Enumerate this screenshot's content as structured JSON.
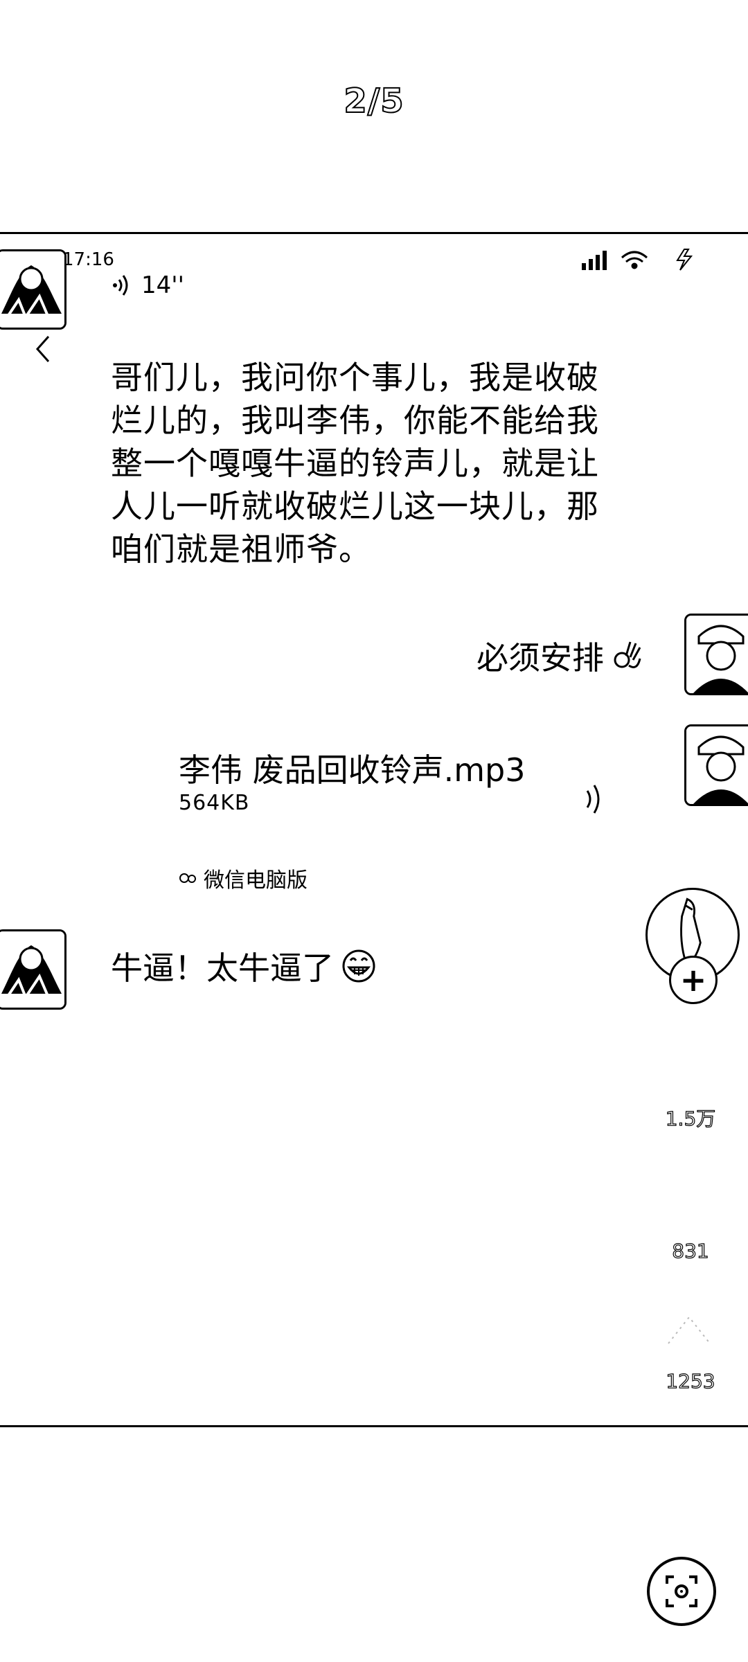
{
  "viewer": {
    "page_counter": "2/5"
  },
  "status_bar": {
    "time": "17:16"
  },
  "chat": {
    "voice_message": {
      "duration": "14''"
    },
    "message_1": "哥们儿，我问你个事儿，我是收破烂儿的，我叫李伟，你能不能给我整一个嘎嘎牛逼的铃声儿，就是让人儿一听就收破烂儿这一块儿，那咱们就是祖师爷。",
    "reply_1": {
      "text": "必须安排",
      "emoji": "ok-hand-emoji"
    },
    "file": {
      "name": "李伟 废品回收铃声.mp3",
      "size": "564KB",
      "source": "微信电脑版"
    },
    "message_2": {
      "text": "牛逼！太牛逼了",
      "emoji": "grinning-emoji"
    }
  },
  "side_actions": {
    "likes": "1.5万",
    "comments": "831",
    "shares": "1253"
  }
}
